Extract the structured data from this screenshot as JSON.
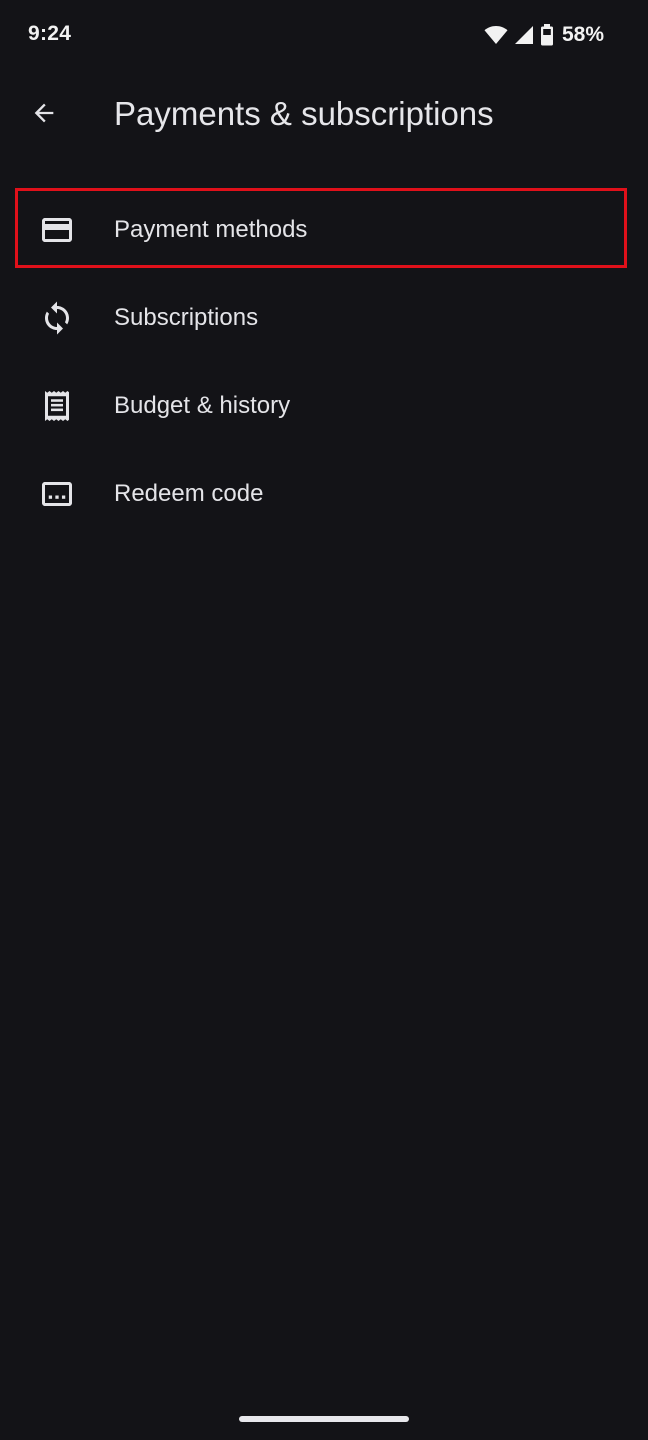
{
  "status_bar": {
    "time": "9:24",
    "battery_percent": "58%",
    "icons": [
      "wifi-icon",
      "cell-signal-icon",
      "battery-icon"
    ]
  },
  "app_bar": {
    "back_icon": "arrow-back-icon",
    "title": "Payments & subscriptions"
  },
  "menu": {
    "items": [
      {
        "label": "Payment methods",
        "icon": "credit-card-icon",
        "highlighted": true
      },
      {
        "label": "Subscriptions",
        "icon": "refresh-icon",
        "highlighted": false
      },
      {
        "label": "Budget & history",
        "icon": "receipt-icon",
        "highlighted": false
      },
      {
        "label": "Redeem code",
        "icon": "redeem-code-icon",
        "highlighted": false
      }
    ]
  },
  "colors": {
    "background": "#131317",
    "text": "#e4e4e8",
    "highlight": "#e0101a"
  }
}
